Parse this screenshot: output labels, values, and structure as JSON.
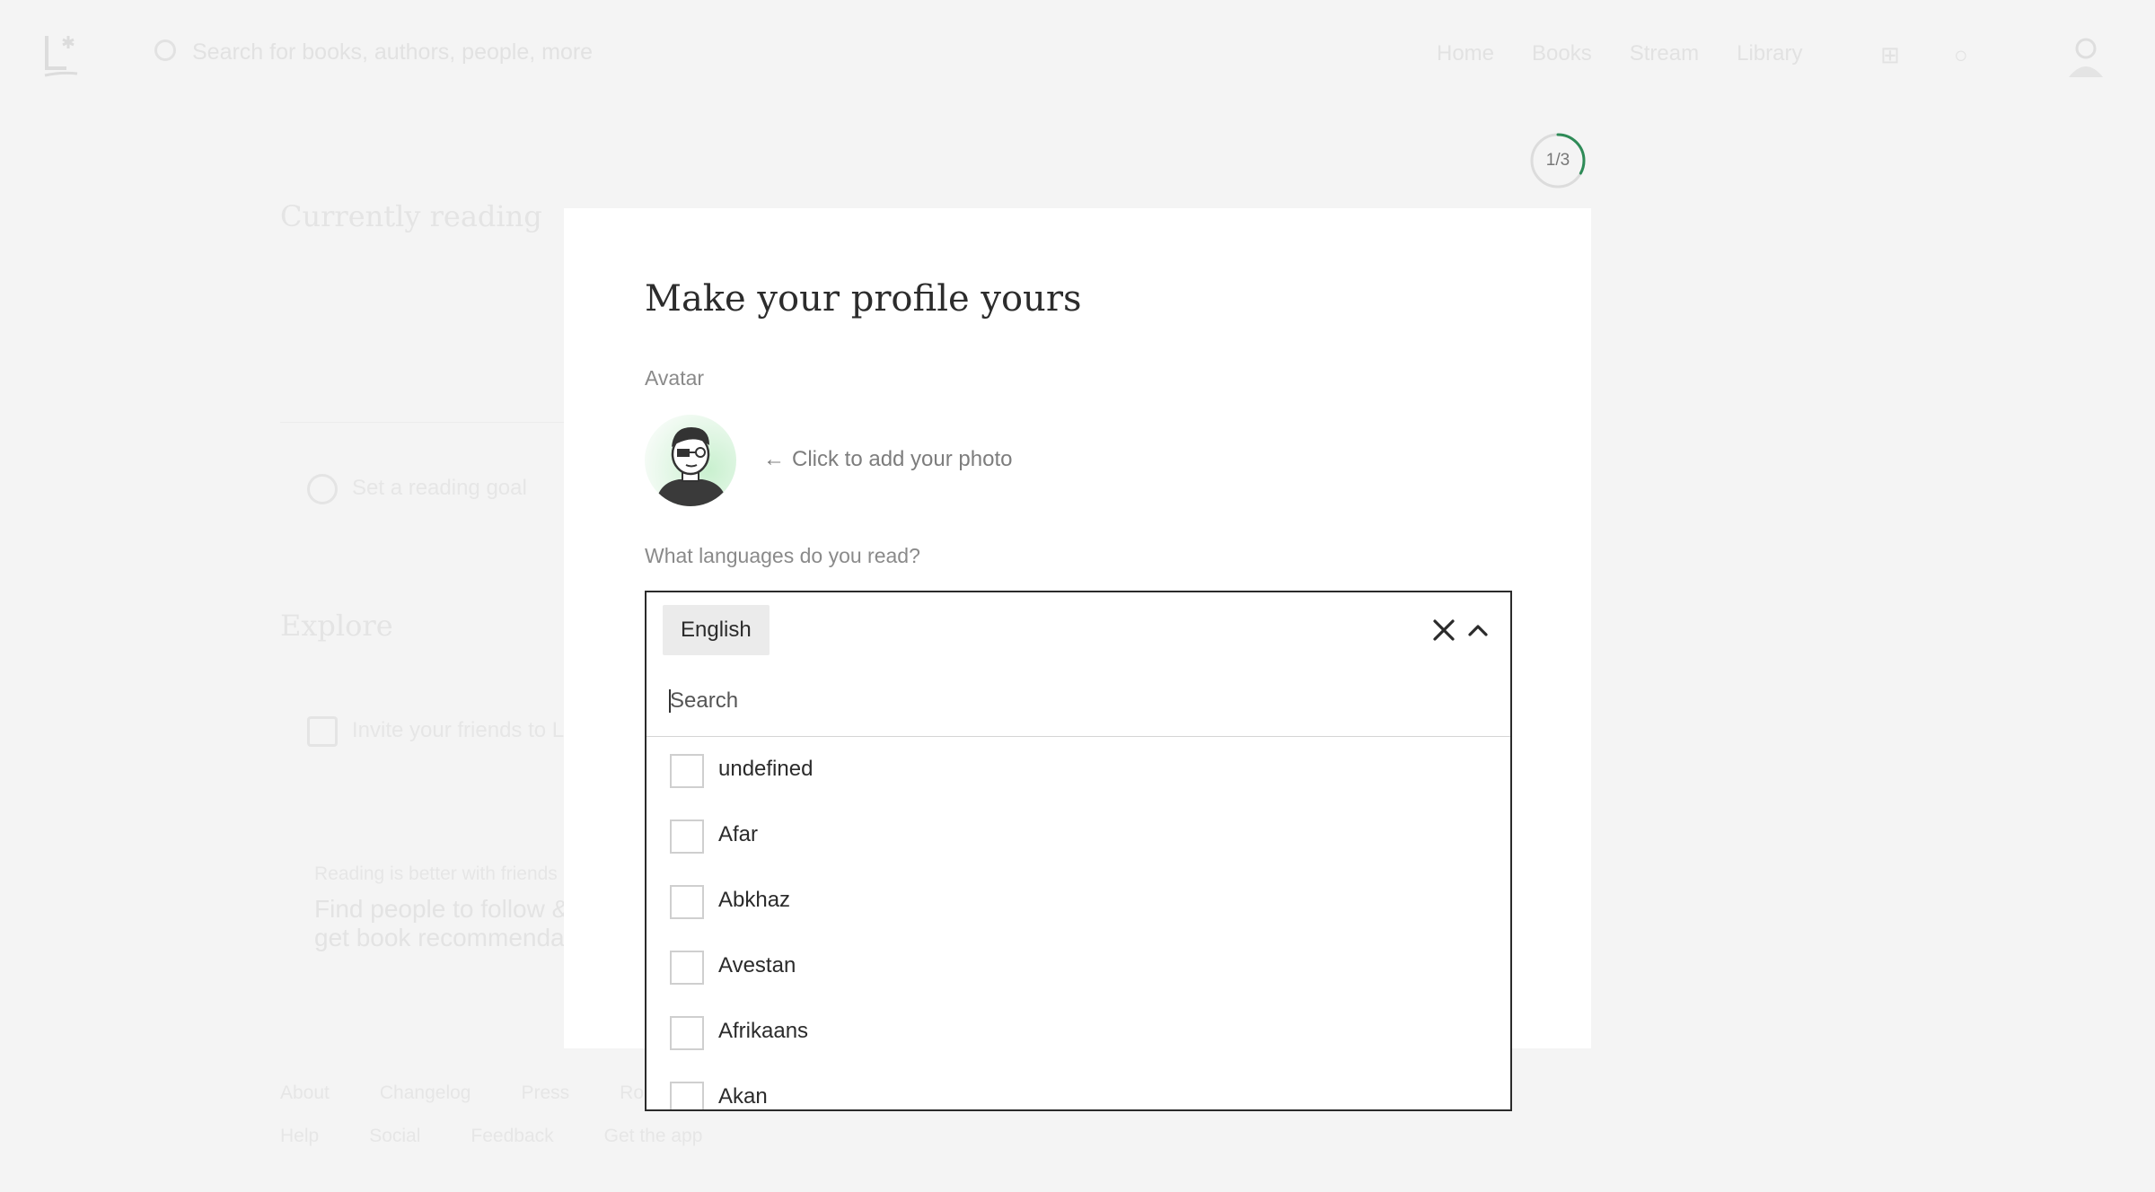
{
  "topbar": {
    "search_placeholder": "Search for books, authors, people, more",
    "nav": [
      "Home",
      "Books",
      "Stream",
      "Library"
    ]
  },
  "background": {
    "currently_reading": "Currently reading",
    "reading_goal": "Set a reading goal",
    "explore": "Explore",
    "invite": "Invite your friends to Literal",
    "promo_small": "Reading is better with friends",
    "promo_line1": "Find people to follow &",
    "promo_line2": "get book recommendations",
    "footer_row1": [
      "About",
      "Changelog",
      "Press",
      "Roadmap"
    ],
    "footer_row2": [
      "Help",
      "Social",
      "Feedback",
      "Get the app"
    ]
  },
  "step": {
    "label": "1/3",
    "progress": 0.33
  },
  "modal": {
    "title": "Make your profile yours",
    "avatar_label": "Avatar",
    "add_photo": "Click to add your photo",
    "languages_label": "What languages do you read?",
    "selected_language": "English",
    "search_placeholder": "Search",
    "options": [
      "undefined",
      "Afar",
      "Abkhaz",
      "Avestan",
      "Afrikaans",
      "Akan"
    ]
  },
  "colors": {
    "accent": "#2e8b57",
    "border": "#2b2b2b",
    "muted": "#8a8a8a"
  }
}
